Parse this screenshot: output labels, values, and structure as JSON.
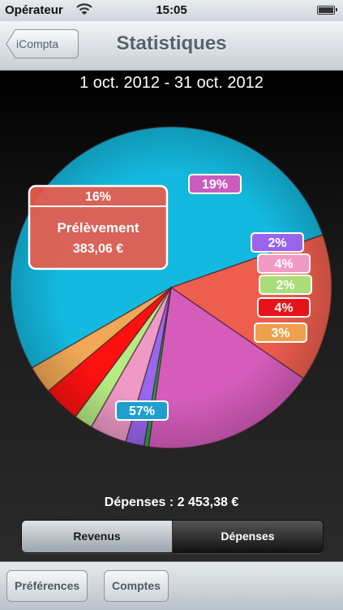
{
  "status_bar": {
    "carrier": "Opérateur",
    "time": "15:05"
  },
  "nav": {
    "back_label": "iCompta",
    "title": "Statistiques"
  },
  "date_range": "1 oct. 2012 - 31 oct. 2012",
  "chart_data": {
    "type": "pie",
    "start_angle_deg": 150,
    "slices": [
      {
        "value": 57,
        "label": "57%",
        "color": "#14b9df",
        "label_color": "#1e9fd0"
      },
      {
        "value": 16,
        "label": "16%",
        "color": "#ee5e4e",
        "label_color": "#ea5b4c",
        "detail_name": "Prélèvement",
        "detail_amount": "383,06 €"
      },
      {
        "value": 19,
        "label": "19%",
        "color": "#d65cbc",
        "label_color": "#c95cbd"
      },
      {
        "value": 0.5,
        "label": "",
        "color": "#28a046",
        "label_color": ""
      },
      {
        "value": 2,
        "label": "2%",
        "color": "#9966ee",
        "label_color": "#9a64ea"
      },
      {
        "value": 4,
        "label": "4%",
        "color": "#ef9ac6",
        "label_color": "#f19ac5"
      },
      {
        "value": 2,
        "label": "2%",
        "color": "#b6ea82",
        "label_color": "#a9dd79"
      },
      {
        "value": 4,
        "label": "4%",
        "color": "#ff1010",
        "label_color": "#e8121a"
      },
      {
        "value": 3,
        "label": "3%",
        "color": "#f1a856",
        "label_color": "#eea04d"
      }
    ]
  },
  "total_label": "Dépenses : 2 453,38 €",
  "segmented": {
    "income": "Revenus",
    "expenses": "Dépenses"
  },
  "toolbar": {
    "preferences": "Préférences",
    "accounts": "Comptes"
  }
}
